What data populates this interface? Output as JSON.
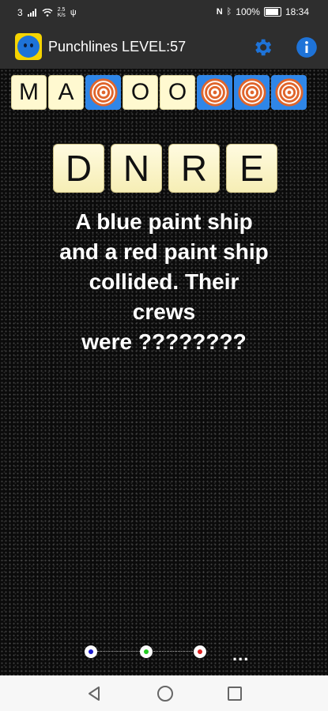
{
  "statusbar": {
    "sim": "3",
    "net_speed": "2.5",
    "net_unit": "K/s",
    "battery": "100%",
    "time": "18:34"
  },
  "header": {
    "title": "Punchlines LEVEL:57",
    "icons": [
      "smiley-logo-icon",
      "gear-icon",
      "info-icon"
    ],
    "accent": "#1e73d8"
  },
  "answer": {
    "slots": [
      {
        "type": "letter",
        "char": "M"
      },
      {
        "type": "letter",
        "char": "A"
      },
      {
        "type": "target",
        "char": ""
      },
      {
        "type": "letter",
        "char": "O"
      },
      {
        "type": "letter",
        "char": "O"
      },
      {
        "type": "target",
        "char": ""
      },
      {
        "type": "target",
        "char": ""
      },
      {
        "type": "target",
        "char": ""
      }
    ]
  },
  "letters": [
    "D",
    "N",
    "R",
    "E"
  ],
  "question": {
    "lines": [
      "A blue paint ship",
      "and a red paint ship",
      "collided. Their",
      "crews",
      "were ????????"
    ]
  },
  "progress": {
    "dot_colors": [
      "#1a1acc",
      "#22cc22",
      "#dd2222"
    ],
    "more": "..."
  },
  "colors": {
    "tile": "#fff9d0",
    "target_bg": "#2f86e8",
    "target_ring": "#e0652c"
  }
}
